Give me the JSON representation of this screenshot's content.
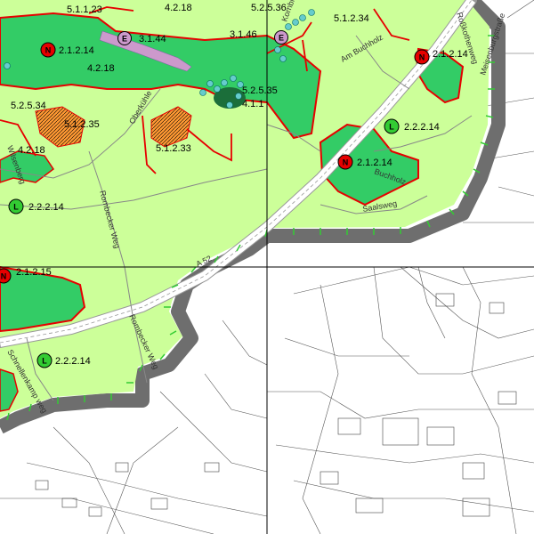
{
  "map": {
    "colors": {
      "light_green": "#ccff99",
      "dark_green": "#33cc66",
      "orange": "#ff9933",
      "boundary": "#e60000",
      "outside": "#6e6e6e",
      "violet": "#cc99cc",
      "road": "#ffffff"
    },
    "labels": {
      "l1": "5.1.1.23",
      "l2": "4.2.18",
      "l3": "5.2.5.36",
      "l4": "5.1.2.34",
      "l5": "2.1.2.14",
      "l6": "3.1.44",
      "l7": "3.1.46",
      "l8": "2.1.2.14",
      "l9": "4.2.18",
      "l10": "5.2.5.35",
      "l11": "4.1.1",
      "l12": "5.2.5.34",
      "l13": "5.1.2.35",
      "l14": "2.2.2.14",
      "l15": "4.2.18",
      "l16": "5.1.2.33",
      "l17": "2.1.2.14",
      "l18": "2.2.2.14",
      "l19": "2.1.2.15",
      "l20": "2.2.2.14"
    },
    "streets": {
      "s1": "Oberkühle",
      "s2": "Am Buchholz",
      "s3": "Roßkothenweg",
      "s4": "Meisenburgstraße",
      "s5": "Buchholz",
      "s6": "Saalsweg",
      "s7": "Wilsenberg",
      "s8": "Rombecker Weg",
      "s9": "A 52",
      "s10": "Rombecker Weg",
      "s11": "Schnellenkamp weg",
      "s12": "Kornbrücke"
    },
    "markers": {
      "n1": "N",
      "n2": "N",
      "n3": "N",
      "n4": "N",
      "e1": "E",
      "e2": "E",
      "lm1": "L",
      "lm2": "L",
      "lm3": "L"
    }
  }
}
